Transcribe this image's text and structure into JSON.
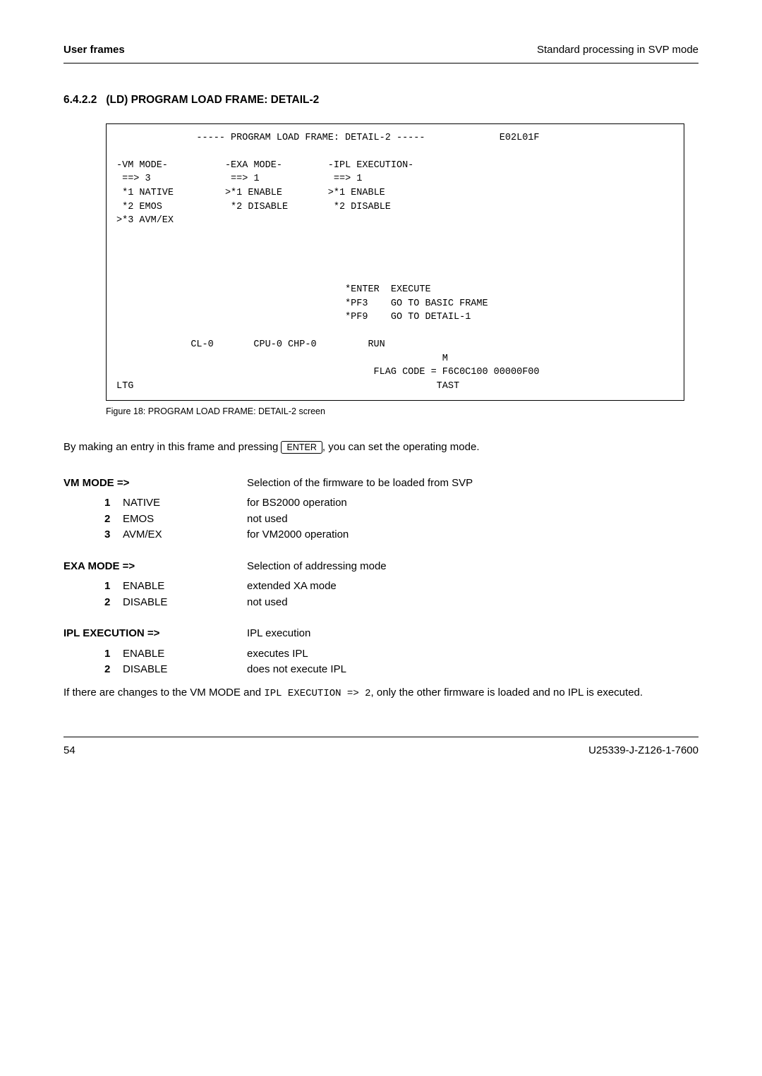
{
  "header": {
    "left": "User frames",
    "right": "Standard processing in SVP mode"
  },
  "section": {
    "number": "6.4.2.2",
    "title": "(LD) PROGRAM LOAD FRAME: DETAIL-2"
  },
  "terminal": {
    "title_line": "              ----- PROGRAM LOAD FRAME: DETAIL-2 -----             E02L01F",
    "col_vm": {
      "header": "-VM MODE-",
      "prompt": " ==> 3",
      "items": [
        " *1 NATIVE",
        " *2 EMOS",
        ">*3 AVM/EX"
      ]
    },
    "col_exa": {
      "header": "-EXA MODE-",
      "prompt": " ==> 1",
      "items": [
        ">*1 ENABLE",
        " *2 DISABLE"
      ]
    },
    "col_ipl": {
      "header": "-IPL EXECUTION-",
      "prompt": " ==> 1",
      "items": [
        ">*1 ENABLE",
        " *2 DISABLE"
      ]
    },
    "pf": {
      "enter": "*ENTER  EXECUTE",
      "pf3": "*PF3    GO TO BASIC FRAME",
      "pf9": "*PF9    GO TO DETAIL-1"
    },
    "status_line": "             CL-0       CPU-0 CHP-0         RUN",
    "status_m": "                                                         M",
    "flag_line": "                                             FLAG CODE = F6C0C100 00000F00",
    "ltg_line": "LTG                                                     TAST"
  },
  "figure_caption": "Figure 18: PROGRAM LOAD FRAME: DETAIL-2 screen",
  "intro": {
    "pre": "By making an entry in this frame and pressing ",
    "key": "ENTER",
    "post": ", you can set the operating mode."
  },
  "groups": [
    {
      "term": "VM MODE  =>",
      "desc": "Selection of the firmware to be loaded from SVP",
      "items": [
        {
          "n": "1",
          "label": "NATIVE",
          "desc": "for BS2000 operation"
        },
        {
          "n": "2",
          "label": "EMOS",
          "desc": "not used"
        },
        {
          "n": "3",
          "label": "AVM/EX",
          "desc": "for VM2000 operation"
        }
      ]
    },
    {
      "term": "EXA MODE =>",
      "desc": "Selection of addressing mode",
      "items": [
        {
          "n": "1",
          "label": "ENABLE",
          "desc": "extended XA mode"
        },
        {
          "n": "2",
          "label": "DISABLE",
          "desc": "not used"
        }
      ]
    },
    {
      "term": "IPL EXECUTION  =>",
      "desc": "IPL execution",
      "items": [
        {
          "n": "1",
          "label": "ENABLE",
          "desc": "executes IPL"
        },
        {
          "n": "2",
          "label": "DISABLE",
          "desc": "does not execute IPL"
        }
      ]
    }
  ],
  "closing": {
    "pre": "If there are changes to the VM MODE and ",
    "code": "IPL EXECUTION => 2",
    "post": ", only the other firmware is loaded and no IPL is executed."
  },
  "footer": {
    "left": "54",
    "right": "U25339-J-Z126-1-7600"
  }
}
